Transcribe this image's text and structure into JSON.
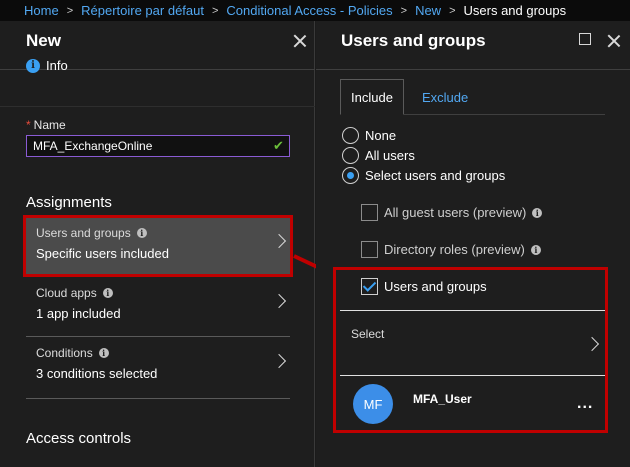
{
  "breadcrumb": {
    "items": [
      "Home",
      "Répertoire par défaut",
      "Conditional Access - Policies",
      "New"
    ],
    "current": "Users and groups",
    "separator": ">"
  },
  "left_blade": {
    "title": "New",
    "info_label": "Info",
    "info_icon": "info-icon",
    "name_label": "Name",
    "required_marker": "*",
    "name_value": "MFA_ExchangeOnline",
    "valid_glyph": "✔",
    "assignments_heading": "Assignments",
    "nav_items": [
      {
        "label": "Users and groups",
        "value": "Specific users included"
      },
      {
        "label": "Cloud apps",
        "value": "1 app included"
      },
      {
        "label": "Conditions",
        "value": "3 conditions selected"
      }
    ],
    "access_controls_heading": "Access controls"
  },
  "right_blade": {
    "title": "Users and groups",
    "tabs": [
      "Include",
      "Exclude"
    ],
    "radios": [
      {
        "label": "None",
        "checked": false
      },
      {
        "label": "All users",
        "checked": false
      },
      {
        "label": "Select users and groups",
        "checked": true
      }
    ],
    "checkboxes": [
      {
        "label": "All guest users (preview)",
        "checked": false
      },
      {
        "label": "Directory roles (preview)",
        "checked": false
      },
      {
        "label": "Users and groups",
        "checked": true
      }
    ],
    "select_label": "Select",
    "selected_user": {
      "initials": "MF",
      "name": "MFA_User"
    },
    "more_glyph": "..."
  },
  "colors": {
    "accent": "#3aa0f3",
    "highlight_box": "#c00000",
    "link": "#52a8f2",
    "input_border": "#8a5bd4",
    "avatar": "#3c8ee8"
  }
}
